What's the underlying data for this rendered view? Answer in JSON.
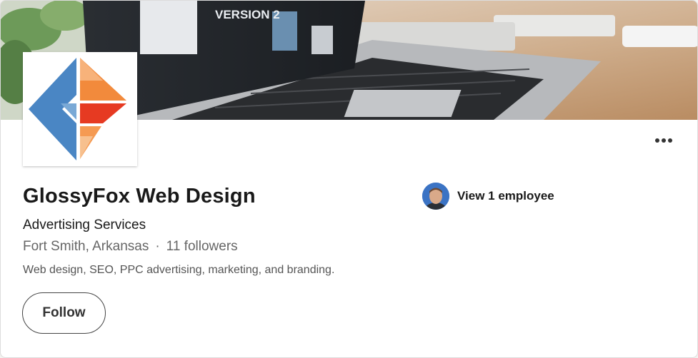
{
  "company": {
    "name": "GlossyFox Web Design",
    "industry": "Advertising Services",
    "location": "Fort Smith, Arkansas",
    "separator": "·",
    "followers": "11 followers",
    "tagline": "Web design, SEO, PPC advertising, marketing, and branding."
  },
  "banner": {
    "screen_text": "VERSION 2"
  },
  "actions": {
    "follow_label": "Follow",
    "more_icon": "more-horizontal-icon"
  },
  "employees": {
    "label": "View 1 employee"
  },
  "colors": {
    "logo_blue": "#4a86c4",
    "logo_orange": "#f28a3c",
    "logo_red": "#e63a22"
  }
}
